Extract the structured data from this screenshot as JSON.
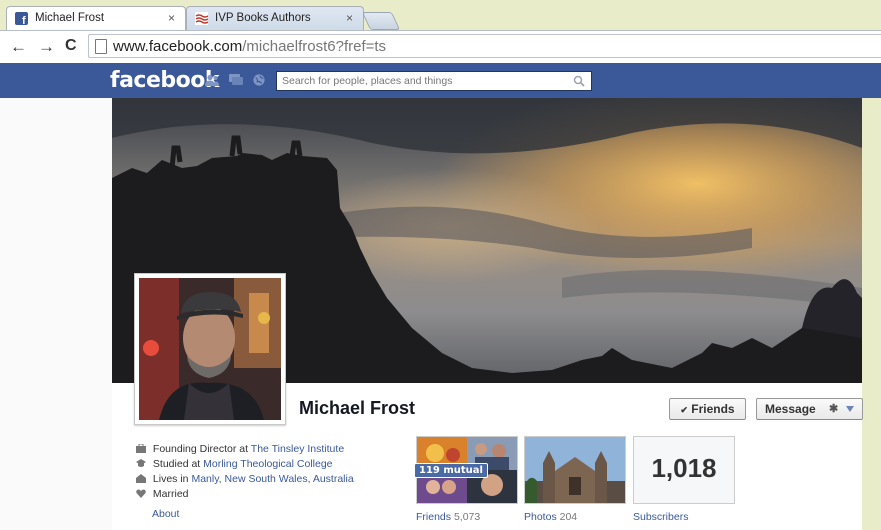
{
  "browser": {
    "tabs": [
      {
        "title": "Michael Frost",
        "active": true,
        "close": "×"
      },
      {
        "title": "IVP Books Authors",
        "active": false,
        "close": "×"
      }
    ],
    "nav": {
      "back": "←",
      "forward": "→",
      "reload": "C"
    },
    "url": {
      "host": "www.facebook.com",
      "path": "/michaelfrost6?fref=ts"
    }
  },
  "fb": {
    "logo": "facebook",
    "search_placeholder": "Search for people, places and things",
    "brand_color": "#3b5998"
  },
  "profile": {
    "name": "Michael Frost",
    "friends_button": "Friends",
    "friends_check": "✔",
    "message_button": "Message",
    "gear": "✱",
    "info": [
      {
        "icon": "briefcase-icon",
        "prefix": "Founding Director at ",
        "link": "The Tinsley Institute"
      },
      {
        "icon": "graduation-cap-icon",
        "prefix": "Studied at ",
        "link": "Morling Theological College"
      },
      {
        "icon": "house-icon",
        "prefix": "Lives in ",
        "link": "Manly, New South Wales, Australia"
      },
      {
        "icon": "heart-icon",
        "prefix": "Married",
        "link": ""
      }
    ],
    "about": "About",
    "mutual_badge": "119 mutual",
    "friends_label": "Friends",
    "friends_count": "5,073",
    "photos_label": "Photos",
    "photos_count": "204",
    "subscribers_count": "1,018",
    "subscribers_label": "Subscribers"
  }
}
